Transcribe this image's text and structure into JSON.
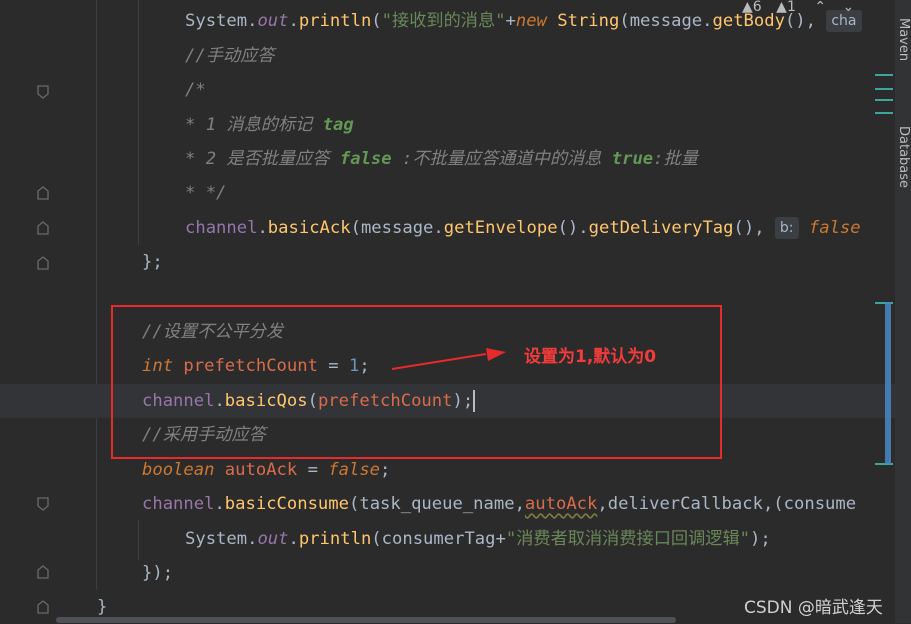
{
  "code": {
    "line1": {
      "sys": "System",
      "out": "out",
      "println": "println",
      "str": "\"接收到的消息\"",
      "plus": "+",
      "new_kw": "new",
      "string_cls": "String",
      "msg": "message",
      "getbody": "getBody",
      "tail": "(), ",
      "hint": "cha"
    },
    "line2": "//手动应答",
    "line3": "/*",
    "line4": {
      "prefix": "* 1 ",
      "text": "消息的标记 ",
      "tag": "tag"
    },
    "line5": {
      "prefix": "* 2 ",
      "text1": "是否批量应答 ",
      "false_kw": "false",
      "text2": " :不批量应答通道中的消息 ",
      "true_kw": "true",
      "text3": ":批量"
    },
    "line6": "* */",
    "line7": {
      "channel": "channel",
      "basicAck": "basicAck",
      "message": "message",
      "getEnvelope": "getEnvelope",
      "getDeliveryTag": "getDeliveryTag",
      "hint": "b:",
      "false_kw": "false"
    },
    "line8": "};",
    "line9": "//设置不公平分发",
    "line10": {
      "int_kw": "int",
      "var": "prefetchCount",
      "eq": " = ",
      "num": "1",
      "semi": ";"
    },
    "line11": {
      "channel": "channel",
      "basicQos": "basicQos",
      "var": "prefetchCount",
      "end": ");"
    },
    "line12": "//采用手动应答",
    "line13": {
      "bool_kw": "boolean",
      "var": "autoAck",
      "eq": " = ",
      "false_kw": "false",
      "semi": ";"
    },
    "line14": {
      "channel": "channel",
      "basicConsume": "basicConsume",
      "arg1": "task_queue_name",
      "arg2": "autoAck",
      "arg3": "deliverCallback",
      "arg4": "(consume"
    },
    "line15": {
      "sys": "System",
      "out": "out",
      "println": "println",
      "arg": "consumerTag",
      "plus": "+",
      "str": "\"消费者取消消费接口回调逻辑\"",
      "end": ");"
    },
    "line16": "});",
    "line17": "}"
  },
  "annotation": {
    "text": "设置为1,默认为0",
    "color": "#e52b2b"
  },
  "right_panel": {
    "maven": "Maven",
    "database": "Database"
  },
  "top_status": {
    "warn_count": "6",
    "weak_count": "1"
  },
  "watermark": "CSDN @暗武逢天"
}
